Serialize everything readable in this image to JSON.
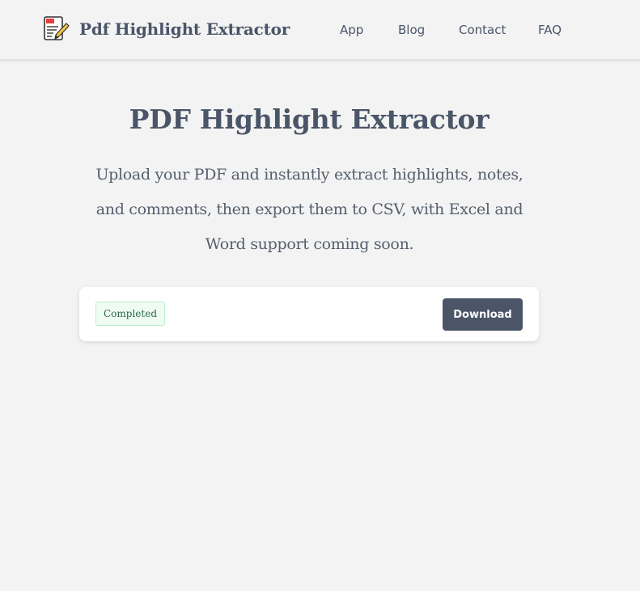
{
  "header": {
    "logo_text": "Pdf Highlight Extractor",
    "logo_icon": "pdf-document-pencil-icon",
    "nav": {
      "app": "App",
      "blog": "Blog",
      "contact": "Contact",
      "faq": "FAQ"
    }
  },
  "main": {
    "title": "PDF Highlight Extractor",
    "description": "Upload your PDF and instantly extract highlights, notes, and comments, then export them to CSV, with Excel and Word support coming soon.",
    "result_card": {
      "status": "Completed",
      "download_label": "Download"
    }
  },
  "colors": {
    "background": "#f3f3f3",
    "text": "#4a5568",
    "button": "#4a5568",
    "badge_bg": "#eefcf2",
    "badge_border": "#b9efc9",
    "badge_text": "#276749"
  }
}
